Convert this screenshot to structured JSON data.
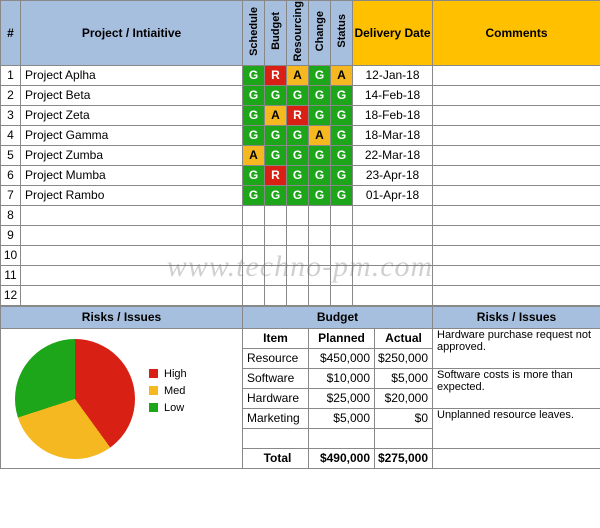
{
  "headers": {
    "num": "#",
    "project": "Project / Intiaitive",
    "schedule": "Schedule",
    "budget": "Budget",
    "resourcing": "Resourcing",
    "change": "Change",
    "status": "Status",
    "delivery": "Delivery Date",
    "comments": "Comments"
  },
  "rows": [
    {
      "n": "1",
      "name": "Project Aplha",
      "rag": [
        "G",
        "R",
        "A",
        "G",
        "A"
      ],
      "date": "12-Jan-18",
      "comment": ""
    },
    {
      "n": "2",
      "name": "Project Beta",
      "rag": [
        "G",
        "G",
        "G",
        "G",
        "G"
      ],
      "date": "14-Feb-18",
      "comment": ""
    },
    {
      "n": "3",
      "name": "Project Zeta",
      "rag": [
        "G",
        "A",
        "R",
        "G",
        "G"
      ],
      "date": "18-Feb-18",
      "comment": ""
    },
    {
      "n": "4",
      "name": "Project Gamma",
      "rag": [
        "G",
        "G",
        "G",
        "A",
        "G"
      ],
      "date": "18-Mar-18",
      "comment": ""
    },
    {
      "n": "5",
      "name": "Project Zumba",
      "rag": [
        "A",
        "G",
        "G",
        "G",
        "G"
      ],
      "date": "22-Mar-18",
      "comment": ""
    },
    {
      "n": "6",
      "name": "Project Mumba",
      "rag": [
        "G",
        "R",
        "G",
        "G",
        "G"
      ],
      "date": "23-Apr-18",
      "comment": ""
    },
    {
      "n": "7",
      "name": "Project Rambo",
      "rag": [
        "G",
        "G",
        "G",
        "G",
        "G"
      ],
      "date": "01-Apr-18",
      "comment": ""
    }
  ],
  "empty_rows": [
    "8",
    "9",
    "10",
    "11",
    "12"
  ],
  "sections": {
    "risks": "Risks / Issues",
    "budget": "Budget",
    "risks2": "Risks / Issues"
  },
  "budget": {
    "columns": {
      "item": "Item",
      "planned": "Planned",
      "actual": "Actual"
    },
    "items": [
      {
        "item": "Resource",
        "planned": "$450,000",
        "actual": "$250,000"
      },
      {
        "item": "Software",
        "planned": "$10,000",
        "actual": "$5,000"
      },
      {
        "item": "Hardware",
        "planned": "$25,000",
        "actual": "$20,000"
      },
      {
        "item": "Marketing",
        "planned": "$5,000",
        "actual": "$0"
      }
    ],
    "total_label": "Total",
    "total_planned": "$490,000",
    "total_actual": "$275,000"
  },
  "issues": [
    "Hardware purchase request not approved.",
    "Software costs is more than expected.",
    "",
    "Unplanned resource leaves."
  ],
  "legend": {
    "high": "High",
    "med": "Med",
    "low": "Low"
  },
  "chart_data": {
    "type": "pie",
    "title": "",
    "categories": [
      "High",
      "Med",
      "Low"
    ],
    "values": [
      40,
      30,
      30
    ],
    "colors": [
      "#D92015",
      "#F5B820",
      "#1DA619"
    ]
  },
  "watermark": "www.techno-pm.com"
}
